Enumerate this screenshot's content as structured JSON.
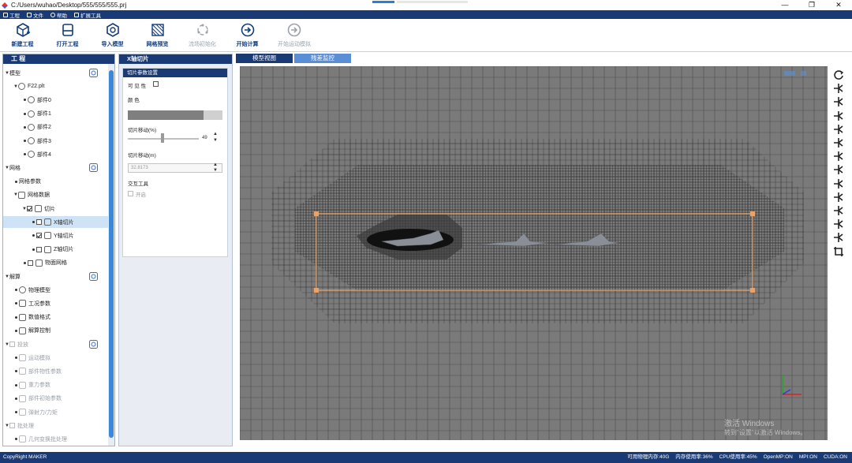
{
  "window": {
    "path": "C:/Users/wuhao/Desktop/555/555/555.prj",
    "controls": [
      "—",
      "❐",
      "✕"
    ]
  },
  "menu": [
    {
      "label": "工程",
      "icon": "file-icon"
    },
    {
      "label": "文件",
      "icon": "folder-icon"
    },
    {
      "label": "帮助",
      "icon": "help-icon"
    },
    {
      "label": "扩展工具",
      "icon": "tools-icon"
    }
  ],
  "toolbar": [
    {
      "label": "新建工程",
      "icon": "new-project-icon",
      "enabled": true
    },
    {
      "label": "打开工程",
      "icon": "open-project-icon",
      "enabled": true
    },
    {
      "label": "导入模型",
      "icon": "import-model-icon",
      "enabled": true
    },
    {
      "label": "网格预览",
      "icon": "mesh-preview-icon",
      "enabled": true
    },
    {
      "label": "流场初始化",
      "icon": "flowfield-init-icon",
      "enabled": false
    },
    {
      "label": "开始计算",
      "icon": "start-compute-icon",
      "enabled": true
    },
    {
      "label": "开始运动模拟",
      "icon": "start-motion-icon",
      "enabled": false
    }
  ],
  "project_panel": {
    "title": "工 程",
    "tree": [
      {
        "label": "模型",
        "level": 0,
        "type": "caret"
      },
      {
        "label": "F22.plt",
        "level": 1,
        "type": "caret",
        "icon": "part-icon"
      },
      {
        "label": "部件0",
        "level": 2,
        "type": "bullet",
        "icon": "part-icon"
      },
      {
        "label": "部件1",
        "level": 2,
        "type": "bullet",
        "icon": "part-icon"
      },
      {
        "label": "部件2",
        "level": 2,
        "type": "bullet",
        "icon": "part-icon"
      },
      {
        "label": "部件3",
        "level": 2,
        "type": "bullet",
        "icon": "part-icon"
      },
      {
        "label": "部件4",
        "level": 2,
        "type": "bullet",
        "icon": "part-icon"
      },
      {
        "label": "网格",
        "level": 0,
        "type": "caret"
      },
      {
        "label": "网格参数",
        "level": 1,
        "type": "bullet"
      },
      {
        "label": "网格数据",
        "level": 1,
        "type": "caret",
        "icon": "mesh-data-icon"
      },
      {
        "label": "切片",
        "level": 2,
        "type": "caret",
        "checkbox": true,
        "checked": true,
        "icon": "pencil-icon"
      },
      {
        "label": "X轴切片",
        "level": 3,
        "type": "bullet",
        "checkbox": true,
        "checked": false,
        "icon": "pencil-icon",
        "selected": true
      },
      {
        "label": "Y轴切片",
        "level": 3,
        "type": "bullet",
        "checkbox": true,
        "checked": true,
        "icon": "pencil-icon"
      },
      {
        "label": "Z轴切片",
        "level": 3,
        "type": "bullet",
        "checkbox": true,
        "checked": false,
        "icon": "pencil-icon"
      },
      {
        "label": "物面网格",
        "level": 2,
        "type": "bullet",
        "checkbox": true,
        "checked": false,
        "icon": "surface-mesh-icon"
      },
      {
        "label": "解算",
        "level": 0,
        "type": "caret"
      },
      {
        "label": "物理模型",
        "level": 1,
        "type": "bullet",
        "icon": "physics-icon"
      },
      {
        "label": "工况参数",
        "level": 1,
        "type": "bullet",
        "icon": "params-icon"
      },
      {
        "label": "数值格式",
        "level": 1,
        "type": "bullet",
        "icon": "numeric-icon"
      },
      {
        "label": "解算控制",
        "level": 1,
        "type": "bullet",
        "icon": "control-icon"
      },
      {
        "label": "投放",
        "level": 0,
        "type": "caret",
        "checkbox": true,
        "checked": false,
        "disabled": true
      },
      {
        "label": "运动模拟",
        "level": 1,
        "type": "bullet",
        "icon": "motion-icon",
        "disabled": true
      },
      {
        "label": "部件物性参数",
        "level": 1,
        "type": "bullet",
        "icon": "property-icon",
        "disabled": true
      },
      {
        "label": "重力参数",
        "level": 1,
        "type": "bullet",
        "icon": "gravity-icon",
        "disabled": true
      },
      {
        "label": "部件初始参数",
        "level": 1,
        "type": "bullet",
        "icon": "initial-icon",
        "disabled": true
      },
      {
        "label": "弹射力/力矩",
        "level": 1,
        "type": "bullet",
        "icon": "eject-icon",
        "disabled": true
      },
      {
        "label": "批处理",
        "level": 0,
        "type": "caret",
        "checkbox": true,
        "checked": false,
        "disabled": true
      },
      {
        "label": "几何变换批处理",
        "level": 1,
        "type": "bullet",
        "icon": "transform-icon",
        "disabled": true
      }
    ]
  },
  "slice_panel": {
    "title": "X轴切片",
    "section_title": "切片参数设置",
    "visible_label": "可 见 性",
    "color_label": "颜 色",
    "color_value": "#7f7f7f",
    "move_pct_label": "切片移动(%)",
    "move_pct_value": "49",
    "move_pct_fraction": 0.49,
    "move_m_label": "切片移动(m)",
    "move_m_value": "32.8173",
    "interactive_label": "交互工具",
    "open_label": "开启"
  },
  "tabs": [
    {
      "label": "模型视图",
      "active": true
    },
    {
      "label": "残差监控",
      "active": false
    }
  ],
  "viewport": {
    "background": "#7a7a7a",
    "mesh_line_color": "#2a2a2a",
    "box_color": "#f0a060",
    "watermark_line1": "激活 Windows",
    "watermark_line2": "转到\"设置\"以激活 Windows。"
  },
  "right_tools": [
    "rotate-icon",
    "view-x-icon",
    "view-neg-x-icon",
    "view-y-icon",
    "view-neg-y-icon",
    "view-z-icon",
    "view-neg-z-icon",
    "iso-view-1-icon",
    "iso-view-2-icon",
    "iso-view-3-icon",
    "iso-view-4-icon",
    "iso-view-5-icon",
    "iso-view-6-icon",
    "fit-view-icon"
  ],
  "status": {
    "copyright": "CopyRight MAKER",
    "items": [
      "可用物理内存:40G",
      "内存使用率:36%",
      "CPU使用率:45%",
      "OpenMP:ON",
      "MPI:ON",
      "CUDA:ON"
    ]
  }
}
